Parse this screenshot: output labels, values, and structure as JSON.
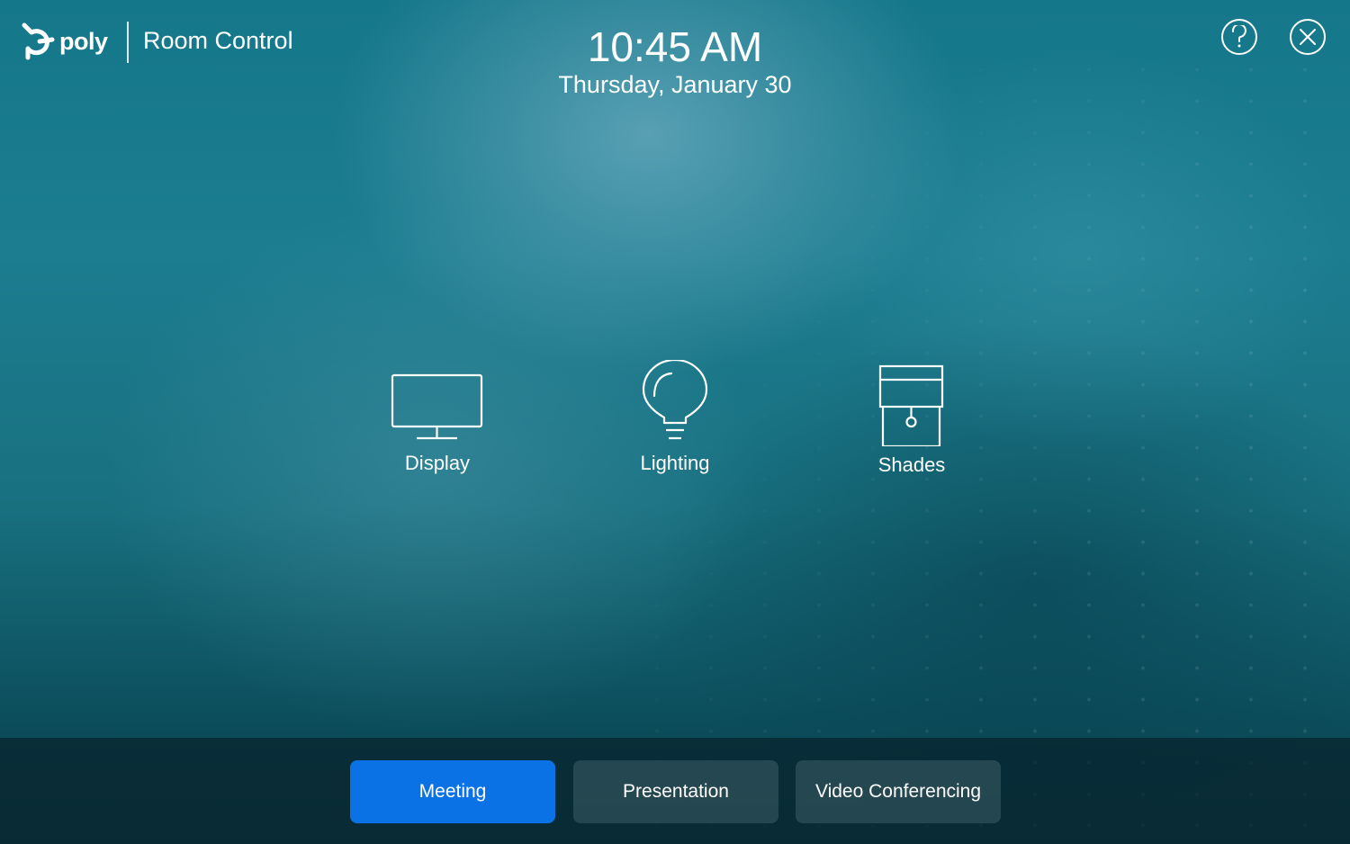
{
  "header": {
    "brand": "poly",
    "app_title": "Room Control",
    "time": "10:45 AM",
    "date": "Thursday, January 30",
    "help_icon": "question-circle-icon",
    "close_icon": "close-circle-icon"
  },
  "controls": [
    {
      "label": "Display",
      "icon": "monitor-icon"
    },
    {
      "label": "Lighting",
      "icon": "lightbulb-icon"
    },
    {
      "label": "Shades",
      "icon": "window-shade-icon"
    }
  ],
  "modes": {
    "selected": "Meeting",
    "items": [
      {
        "label": "Meeting",
        "active": true
      },
      {
        "label": "Presentation",
        "active": false
      },
      {
        "label": "Video Conferencing",
        "active": false
      }
    ]
  },
  "colors": {
    "accent": "#0b72e6",
    "background": "#15778a",
    "bottom_bar": "#08232d"
  }
}
